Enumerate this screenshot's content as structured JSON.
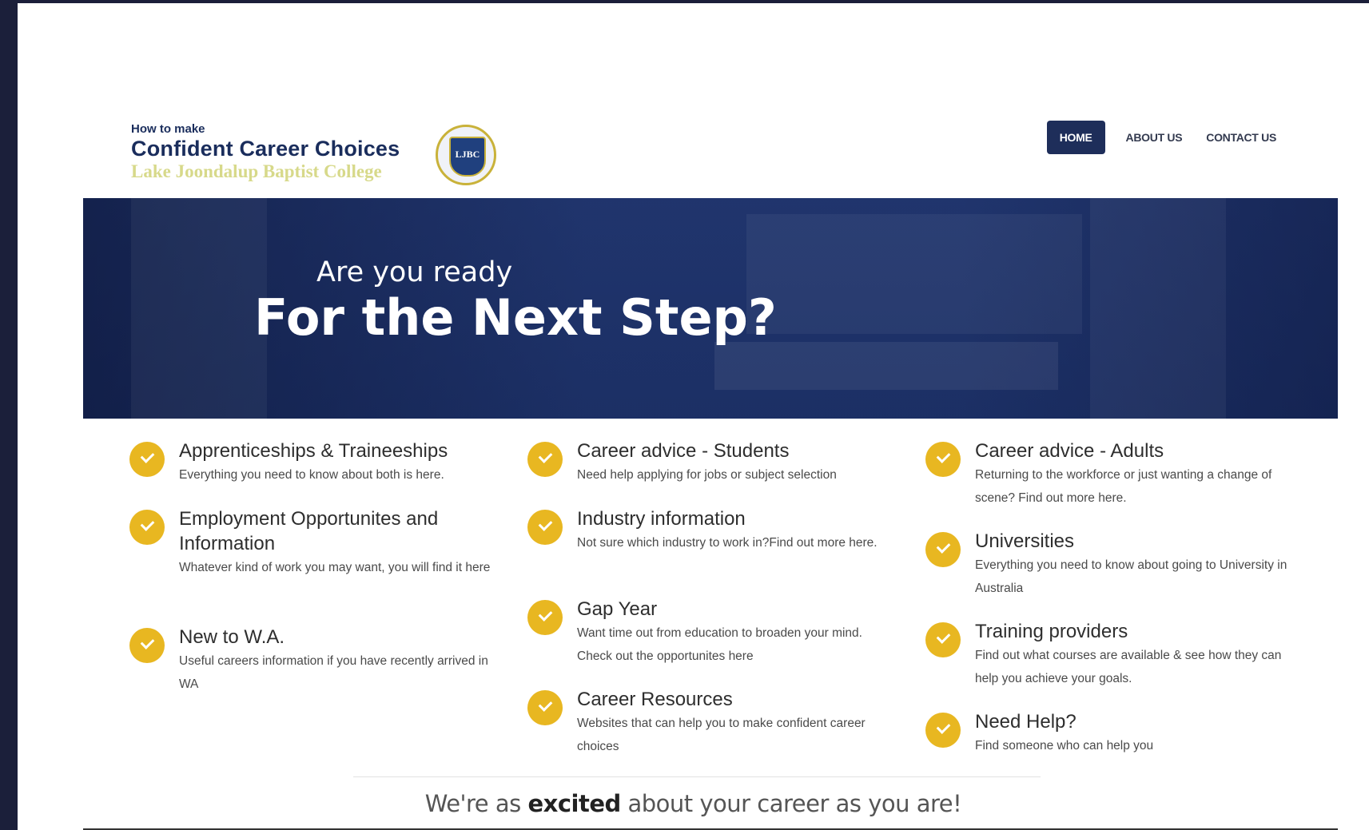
{
  "header": {
    "logo_small": "How to make",
    "logo_main": "Confident Career Choices",
    "logo_college": "Lake Joondalup Baptist College",
    "crest_text": "LJBC"
  },
  "nav": {
    "home": "HOME",
    "about": "ABOUT US",
    "contact": "CONTACT US"
  },
  "hero": {
    "subtitle": "Are you ready",
    "title": "For the Next Step?"
  },
  "features": [
    {
      "title": "Apprenticeships & Traineeships",
      "desc": "Everything you need to know about both is here."
    },
    {
      "title": "Employment Opportunites and Information",
      "desc": "Whatever kind of work you may want, you will find it here"
    },
    {
      "title": "New to W.A.",
      "desc": "Useful careers information if you have recently arrived in WA"
    },
    {
      "title": "Career advice - Students",
      "desc": "Need help applying for jobs or subject selection"
    },
    {
      "title": "Industry information",
      "desc": "Not sure which industry to work in?Find out more here."
    },
    {
      "title": "Gap Year",
      "desc": "Want time out from education to broaden your mind. Check out the opportunites here"
    },
    {
      "title": "Career Resources",
      "desc": "Websites that can help you to make confident career choices"
    },
    {
      "title": "Career advice - Adults",
      "desc": "Returning to the workforce or just wanting a change of scene? Find out more here."
    },
    {
      "title": "Universities",
      "desc": "Everything you need to know about going to University in Australia"
    },
    {
      "title": "Training providers",
      "desc": "Find out what courses are available & see how they can help you achieve your goals."
    },
    {
      "title": "Need Help?",
      "desc": "Find someone who can help you"
    }
  ],
  "tagline": {
    "before": "We're as ",
    "bold": "excited",
    "after": " about your career as you are!"
  },
  "colors": {
    "navy": "#1e2e5a",
    "hero": "#1d3269",
    "accent": "#e8b721"
  },
  "icons": {
    "feature": "check-circle-icon"
  }
}
